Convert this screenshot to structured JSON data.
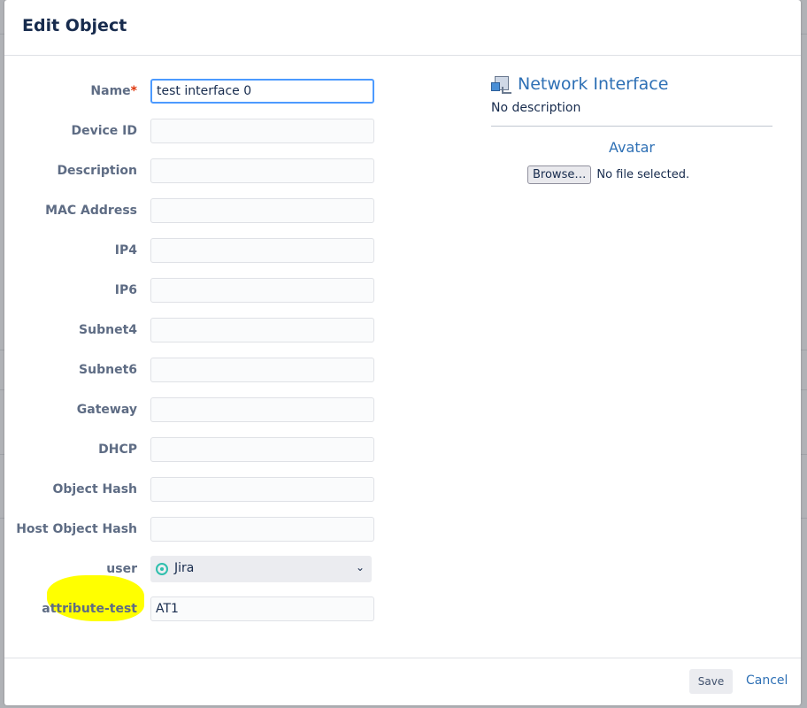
{
  "dialog": {
    "title": "Edit Object"
  },
  "form": {
    "fields": [
      {
        "label": "Name",
        "value": "test interface 0",
        "placeholder": ""
      },
      {
        "label": "Device ID",
        "value": "",
        "placeholder": ""
      },
      {
        "label": "Description",
        "value": "",
        "placeholder": ""
      },
      {
        "label": "MAC Address",
        "value": "",
        "placeholder": ""
      },
      {
        "label": "IP4",
        "value": "",
        "placeholder": ""
      },
      {
        "label": "IP6",
        "value": "",
        "placeholder": ""
      },
      {
        "label": "Subnet4",
        "value": "",
        "placeholder": ""
      },
      {
        "label": "Subnet6",
        "value": "",
        "placeholder": ""
      },
      {
        "label": "Gateway",
        "value": "",
        "placeholder": ""
      },
      {
        "label": "DHCP",
        "value": "",
        "placeholder": ""
      },
      {
        "label": "Object Hash",
        "value": "",
        "placeholder": ""
      },
      {
        "label": "Host Object Hash",
        "value": "",
        "placeholder": ""
      }
    ],
    "required_marker": "*",
    "user": {
      "label": "user",
      "selected": "Jira",
      "icon": "jira-user-icon"
    },
    "attribute_test": {
      "label": "attribute-test",
      "value": "AT1"
    },
    "highlight_color": "#ffff00"
  },
  "object_type": {
    "icon": "network-interface-icon",
    "name": "Network Interface",
    "description": "No description"
  },
  "avatar": {
    "title": "Avatar",
    "browse_label": "Browse…",
    "file_status": "No file selected."
  },
  "footer": {
    "save_label": "Save",
    "cancel_label": "Cancel"
  },
  "colors": {
    "accent": "#2e70b5",
    "focus_border": "#4c9aff",
    "required": "#de350b"
  }
}
